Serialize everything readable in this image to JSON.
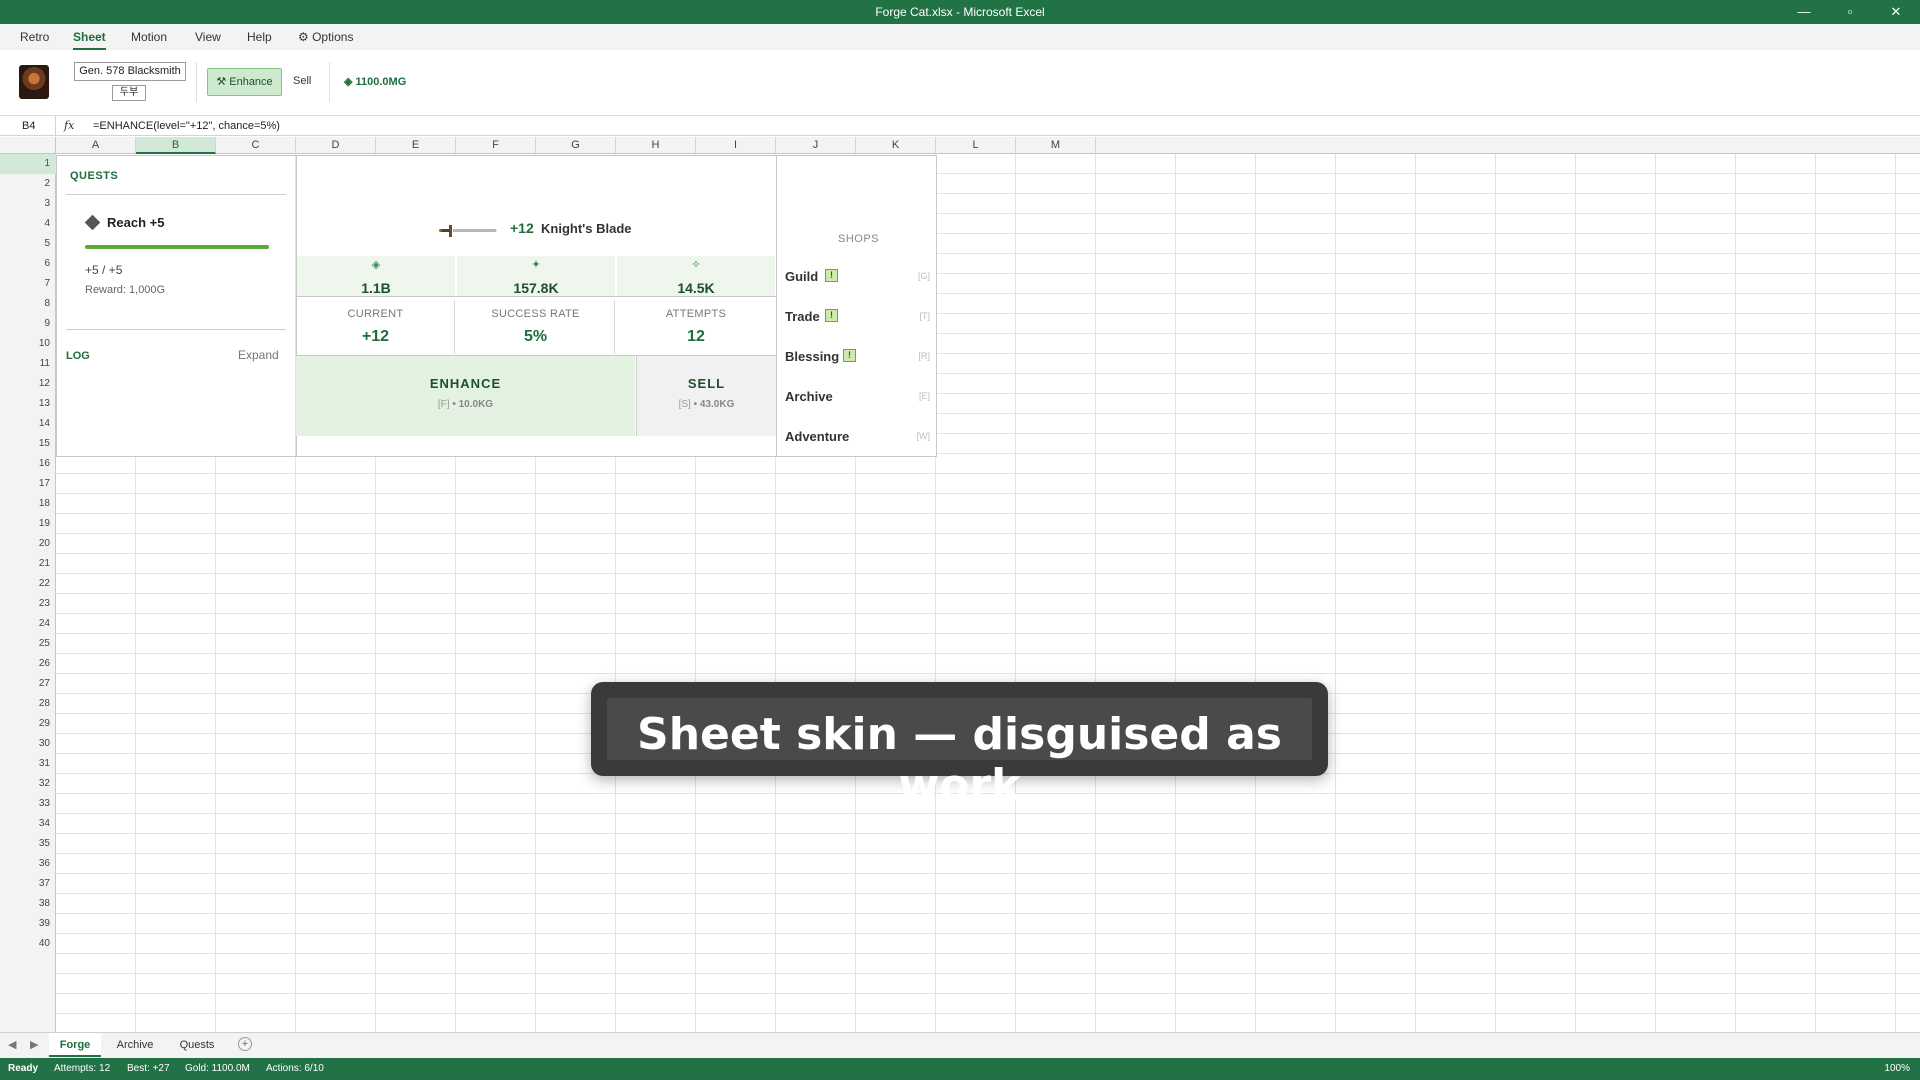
{
  "window": {
    "title": "Forge Cat.xlsx - Microsoft Excel",
    "minimize": "—",
    "maximize": "▫",
    "close": "✕"
  },
  "menu": {
    "items": [
      "Retro",
      "Sheet",
      "Motion",
      "View",
      "Help",
      "⚙ Options"
    ],
    "active": "Sheet"
  },
  "ribbon": {
    "player_name": "Gen. 578 Blacksmith",
    "player_sub": "두부",
    "enhance_label": "⚒ Enhance",
    "sell_label": "Sell",
    "gold": "◈ 1100.0MG"
  },
  "formula_bar": {
    "cell_ref": "B4",
    "fx": "fx",
    "formula": "=ENHANCE(level=\"+12\", chance=5%)"
  },
  "columns": [
    "A",
    "B",
    "C",
    "D",
    "E",
    "F",
    "G",
    "H",
    "I",
    "J",
    "K",
    "L",
    "M"
  ],
  "active_column": "B",
  "rows": [
    "1",
    "2",
    "3",
    "4",
    "5",
    "6",
    "7",
    "8",
    "9",
    "10",
    "11",
    "12",
    "13",
    "14",
    "15",
    "16",
    "17",
    "18",
    "19",
    "20",
    "21",
    "22",
    "23",
    "24",
    "25",
    "26",
    "27",
    "28",
    "29",
    "30",
    "31",
    "32",
    "33",
    "34",
    "35",
    "36",
    "37",
    "38",
    "39",
    "40"
  ],
  "active_row": "1",
  "quests": {
    "title": "QUESTS",
    "name": "Reach +5",
    "progress_text": "+5 / +5",
    "progress_fraction": 1.0,
    "reward": "Reward: 1,000G"
  },
  "log": {
    "title": "LOG",
    "expand": "Expand"
  },
  "item": {
    "level": "+12",
    "name": "Knight's Blade"
  },
  "stats": [
    {
      "icon": "◈",
      "value": "1.1B"
    },
    {
      "icon": "✦",
      "value": "157.8K"
    },
    {
      "icon": "✧",
      "value": "14.5K"
    }
  ],
  "info": [
    {
      "label": "CURRENT",
      "value": "+12"
    },
    {
      "label": "SUCCESS RATE",
      "value": "5%"
    },
    {
      "label": "ATTEMPTS",
      "value": "12"
    }
  ],
  "actions": {
    "enhance_label": "ENHANCE",
    "enhance_key": "[F]",
    "enhance_cost": "• 10.0KG",
    "sell_label": "SELL",
    "sell_key": "[S]",
    "sell_price": "• 43.0KG"
  },
  "shops": {
    "title": "SHOPS",
    "items": [
      {
        "name": "Guild",
        "badge": "!",
        "key": "[G]"
      },
      {
        "name": "Trade",
        "badge": "!",
        "key": "[T]"
      },
      {
        "name": "Blessing",
        "badge": "!",
        "key": "[R]"
      },
      {
        "name": "Archive",
        "badge": "",
        "key": "[E]"
      },
      {
        "name": "Adventure",
        "badge": "",
        "key": "[W]"
      }
    ]
  },
  "toast": {
    "text": "Sheet skin — disguised as work"
  },
  "sheet_tabs": {
    "tabs": [
      "Forge",
      "Archive",
      "Quests"
    ],
    "active": "Forge",
    "prev": "◀",
    "next": "▶",
    "add": "+"
  },
  "status": {
    "ready": "Ready",
    "attempts": "Attempts: 12",
    "best": "Best: +27",
    "gold": "Gold: 1100.0M",
    "actions": "Actions: 6/10",
    "zoom": "100%"
  },
  "colors": {
    "brand": "#217346",
    "accent": "#1e6e3c",
    "progress": "#59a93a"
  }
}
